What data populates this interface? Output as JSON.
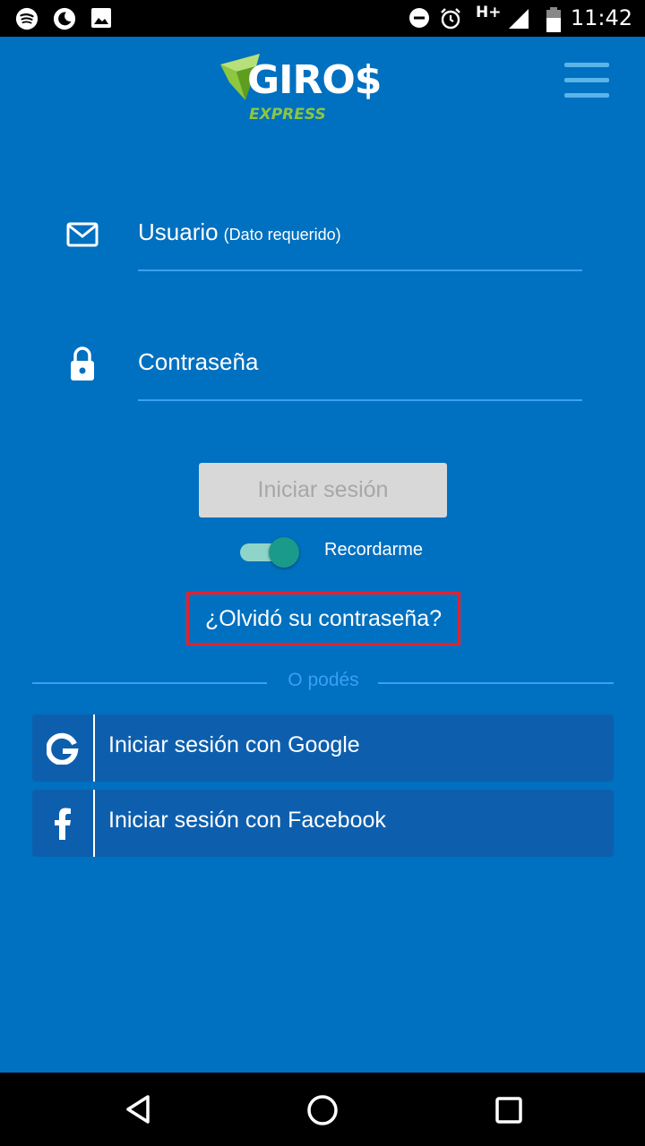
{
  "status_bar": {
    "time": "11:42",
    "network": "H+",
    "icons": [
      "spotify-icon",
      "moon-icon",
      "image-icon",
      "do-not-disturb-icon",
      "alarm-icon",
      "signal-icon",
      "battery-icon"
    ]
  },
  "header": {
    "logo_text": "GIRO$",
    "logo_sub": "EXPRESS",
    "menu_icon": "hamburger-menu-icon"
  },
  "form": {
    "username_label": "Usuario",
    "username_hint": "(Dato requerido)",
    "password_label": "Contraseña",
    "login_button": "Iniciar sesión",
    "remember_label": "Recordarme",
    "remember_on": true,
    "forgot_link": "¿Olvidó su contraseña?"
  },
  "divider": {
    "label": "O podés"
  },
  "social": {
    "google_label": "Iniciar sesión con Google",
    "facebook_label": "Iniciar sesión con Facebook"
  },
  "colors": {
    "background": "#0070c0",
    "accent_line": "#3aa0f0",
    "social_button": "#0d5fae",
    "toggle_thumb": "#1a9a8a",
    "logo_green": "#8dc63f",
    "highlight_border": "#e8202a"
  },
  "nav": {
    "icons": [
      "back-icon",
      "home-icon",
      "recents-icon"
    ]
  }
}
